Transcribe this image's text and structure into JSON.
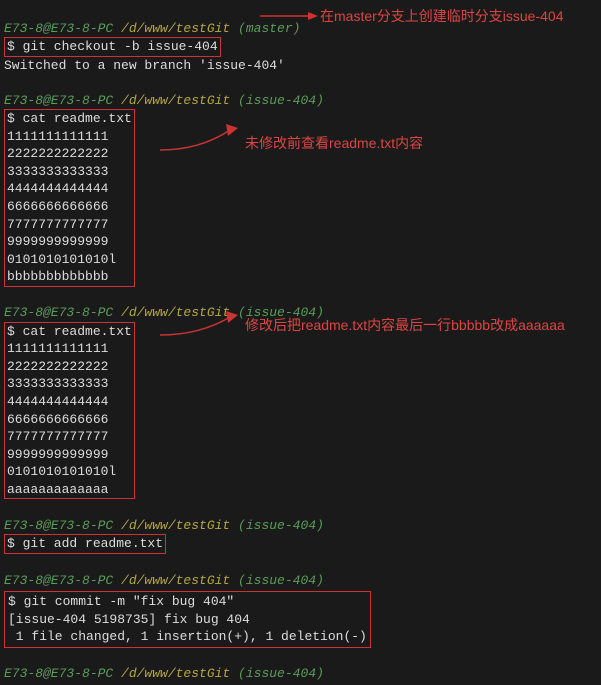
{
  "prompt1": "E73-8@E73-8-PC",
  "path1": " /d/www/testGit",
  "branch_master": " (master)",
  "branch_issue": " (issue-404)",
  "cmd_checkout": "$ git checkout -b issue-404",
  "out_switched": "Switched to a new branch 'issue-404'",
  "cmd_cat": "$ cat readme.txt",
  "line_1": "1111111111111",
  "line_2": "2222222222222",
  "line_3": "3333333333333",
  "line_4": "4444444444444",
  "line_5": "6666666666666",
  "line_6": "7777777777777",
  "line_7": "9999999999999",
  "line_8": "0101010101010l",
  "line_b": "bbbbbbbbbbbbb",
  "line_a": "aaaaaaaaaaaaa",
  "cmd_add": "$ git add readme.txt",
  "cmd_commit": "$ git commit -m \"fix bug 404\"",
  "out_commit1": "[issue-404 5198735] fix bug 404",
  "out_commit2": " 1 file changed, 1 insertion(+), 1 deletion(-)",
  "anno1": "在master分支上创建临时分支issue-404",
  "anno2": "未修改前查看readme.txt内容",
  "anno3": "修改后把readme.txt内容最后一行bbbbb改成aaaaaa"
}
